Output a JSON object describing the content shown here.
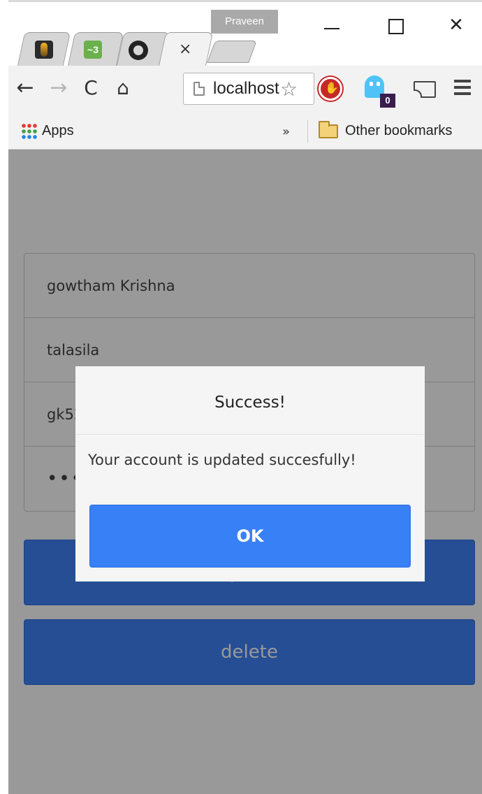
{
  "browser": {
    "profile_name": "Praveen",
    "tabs": [
      {
        "icon": "bulb-favicon-icon",
        "fav_text": ""
      },
      {
        "icon": "w3c-favicon-icon",
        "fav_text": "~3"
      },
      {
        "icon": "github-favicon-icon",
        "fav_text": ""
      },
      {
        "icon": "blank",
        "active": true,
        "close_glyph": "×"
      }
    ],
    "window_close_glyph": "✕",
    "toolbar": {
      "back_glyph": "←",
      "forward_glyph": "→",
      "reload_glyph": "C",
      "home_glyph": "⌂",
      "url": "localhost",
      "star_glyph": "☆",
      "extension_badge": "0"
    },
    "bookmarks": {
      "apps_label": "Apps",
      "overflow_glyph": "»",
      "other_label": "Other bookmarks"
    }
  },
  "form": {
    "fields": [
      {
        "value": "gowtham Krishna"
      },
      {
        "value": "talasila"
      },
      {
        "value": "gk52"
      },
      {
        "value": "••••••"
      }
    ],
    "update_label": "Update",
    "delete_label": "delete"
  },
  "modal": {
    "title": "Success!",
    "message": "Your account is updated succesfully!",
    "ok_label": "OK"
  },
  "colors": {
    "primary": "#3f82f7",
    "overlay": "rgba(0,0,0,0.4)",
    "stop_extension": "#c62828",
    "ghost_extension": "#4fc3f7"
  }
}
